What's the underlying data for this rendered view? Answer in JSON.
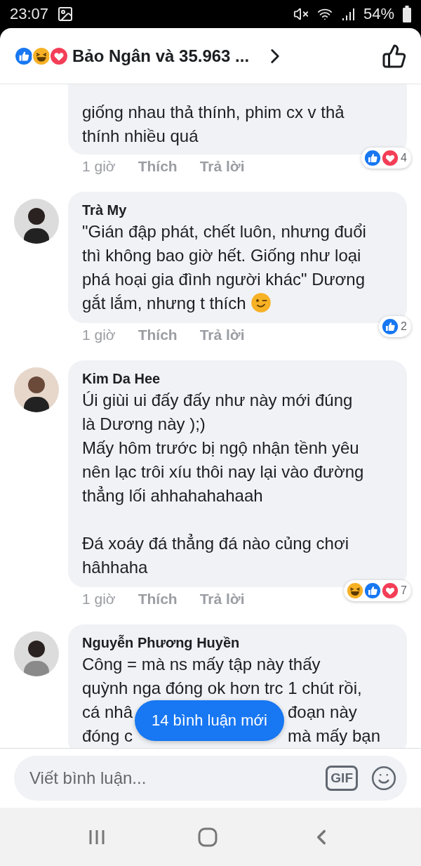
{
  "status_bar": {
    "time": "23:07",
    "battery": "54%"
  },
  "header": {
    "reactions": [
      {
        "kind": "like"
      },
      {
        "kind": "haha"
      },
      {
        "kind": "love"
      }
    ],
    "summary": "Bảo Ngân và 35.963 ..."
  },
  "comments": [
    {
      "text": "giống nhau thả thính, phim cx v thả\nthính nhiều quá",
      "time": "1 giờ",
      "like": "Thích",
      "reply": "Trả lời",
      "reactions": [
        {
          "kind": "like"
        },
        {
          "kind": "love"
        }
      ],
      "count": "4"
    },
    {
      "name": "Trà My",
      "text": "\"Gián đập phát, chết luôn, nhưng đuổi\nthì không bao giờ hết. Giống như loại\nphá hoại gia đình người khác\" Dương\ngắt lắm, nhưng t thích",
      "emoji": {
        "kind": "wink"
      },
      "time": "1 giờ",
      "like": "Thích",
      "reply": "Trả lời",
      "reactions": [
        {
          "kind": "like"
        }
      ],
      "count": "2"
    },
    {
      "name": "Kim Da Hee",
      "text": "Úi giùi ui đấy đấy như này mới đúng\nlà Dương này );)\nMấy hôm trước bị ngộ nhận tềnh yêu\nnên lạc trôi xíu thôi nay lại vào đường\nthẳng lối ahhahahahaah\n\nĐá xoáy đá thẳng đá nào củng chơi\nhâhhaha",
      "time": "1 giờ",
      "like": "Thích",
      "reply": "Trả lời",
      "reactions": [
        {
          "kind": "haha"
        },
        {
          "kind": "like"
        },
        {
          "kind": "love"
        }
      ],
      "count": "7"
    },
    {
      "name": "Nguyễn Phương Huyền",
      "text": "Công = mà ns mấy tập này thấy\nquỳnh nga đóng ok hơn trc 1 chút rồi,",
      "covered_lines": [
        [
          "cá nhâ",
          "đoạn này"
        ],
        [
          "đóng c",
          "mà mấy bạn"
        ]
      ]
    }
  ],
  "new_comments": "14 bình luận mới",
  "composer": {
    "placeholder": "Viết bình luận...",
    "gif": "GIF"
  }
}
